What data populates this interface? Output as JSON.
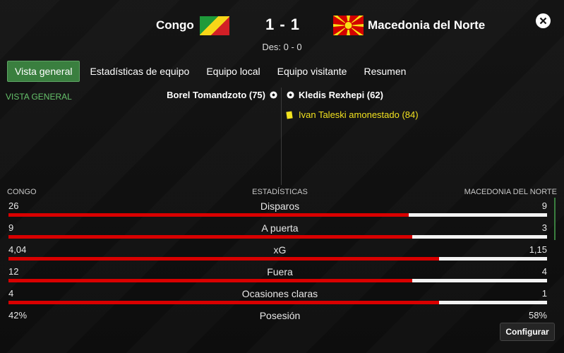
{
  "match": {
    "home_team": "Congo",
    "away_team": "Macedonia del Norte",
    "score": "1 - 1",
    "halftime": "Des: 0 - 0"
  },
  "tabs": [
    {
      "label": "Vista general",
      "active": true
    },
    {
      "label": "Estadísticas de equipo",
      "active": false
    },
    {
      "label": "Equipo local",
      "active": false
    },
    {
      "label": "Equipo visitante",
      "active": false
    },
    {
      "label": "Resumen",
      "active": false
    }
  ],
  "section_label": "VISTA GENERAL",
  "events": {
    "home_goal": "Borel Tomandzoto (75)",
    "away_goal": "Kledis Rexhepi (62)",
    "away_card": "Ivan Taleski amonestado (84)"
  },
  "stats_header": {
    "home": "CONGO",
    "center": "ESTADÍSTICAS",
    "away": "MACEDONIA DEL NORTE"
  },
  "stats": [
    {
      "name": "Disparos",
      "home": "26",
      "away": "9",
      "home_share": 0.743
    },
    {
      "name": "A puerta",
      "home": "9",
      "away": "3",
      "home_share": 0.75
    },
    {
      "name": "xG",
      "home": "4,04",
      "away": "1,15",
      "home_share": 0.8
    },
    {
      "name": "Fuera",
      "home": "12",
      "away": "4",
      "home_share": 0.75
    },
    {
      "name": "Ocasiones claras",
      "home": "4",
      "away": "1",
      "home_share": 0.8
    },
    {
      "name": "Posesión",
      "home": "42%",
      "away": "58%",
      "home_share": 0.42
    }
  ],
  "buttons": {
    "configure": "Configurar"
  },
  "colors": {
    "accent_green": "#3a7f3f",
    "home_bar": "#d90000",
    "away_bar": "#f2f2f2",
    "card_yellow": "#f2e21f"
  },
  "icons": {
    "close": "close-icon",
    "goal": "soccer-ball-icon",
    "card": "yellow-card-icon"
  }
}
